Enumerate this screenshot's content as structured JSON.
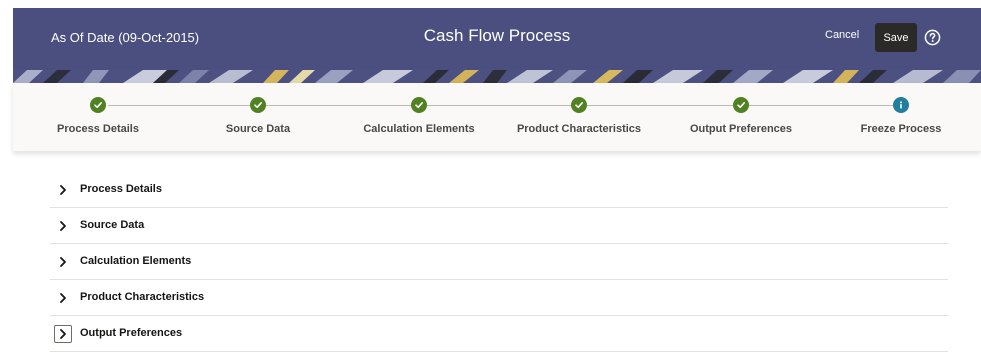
{
  "header": {
    "as_of": "As Of Date (09-Oct-2015)",
    "title": "Cash Flow Process",
    "cancel_label": "Cancel",
    "save_label": "Save",
    "help_icon": "help-circle-icon",
    "background_color": "#4a4f7f"
  },
  "train": {
    "steps": [
      {
        "label": "Process Details",
        "state": "complete",
        "icon": "check-icon"
      },
      {
        "label": "Source Data",
        "state": "complete",
        "icon": "check-icon"
      },
      {
        "label": "Calculation Elements",
        "state": "complete",
        "icon": "check-icon"
      },
      {
        "label": "Product Characteristics",
        "state": "complete",
        "icon": "check-icon"
      },
      {
        "label": "Output Preferences",
        "state": "complete",
        "icon": "check-icon"
      },
      {
        "label": "Freeze Process",
        "state": "current",
        "icon": "info-icon"
      }
    ],
    "complete_color": "#508223",
    "current_color": "#227e9e"
  },
  "sections": {
    "items": [
      {
        "label": "Process Details",
        "expanded": false
      },
      {
        "label": "Source Data",
        "expanded": false
      },
      {
        "label": "Calculation Elements",
        "expanded": false
      },
      {
        "label": "Product Characteristics",
        "expanded": false
      },
      {
        "label": "Output Preferences",
        "expanded": false,
        "focused": true
      }
    ]
  }
}
